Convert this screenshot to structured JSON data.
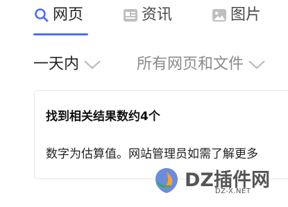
{
  "tabs": [
    {
      "label": "网页",
      "icon": "search-icon",
      "active": true
    },
    {
      "label": "资讯",
      "icon": "news-icon",
      "active": false
    },
    {
      "label": "图片",
      "icon": "image-icon",
      "active": false
    }
  ],
  "filters": {
    "time": {
      "label": "一天内",
      "icon": "chevron-down-icon"
    },
    "type": {
      "label": "所有网页和文件",
      "icon": "chevron-down-icon"
    }
  },
  "result_card": {
    "title": "找到相关结果数约4个",
    "body": "数字为估算值。网站管理员如需了解更多"
  },
  "watermark": {
    "brand": "DZ插件网",
    "domain": "DZ-X.NET"
  },
  "colors": {
    "accent": "#4e6ef2",
    "inactive_text": "#8a8a8a",
    "border": "#e6e6e6"
  }
}
